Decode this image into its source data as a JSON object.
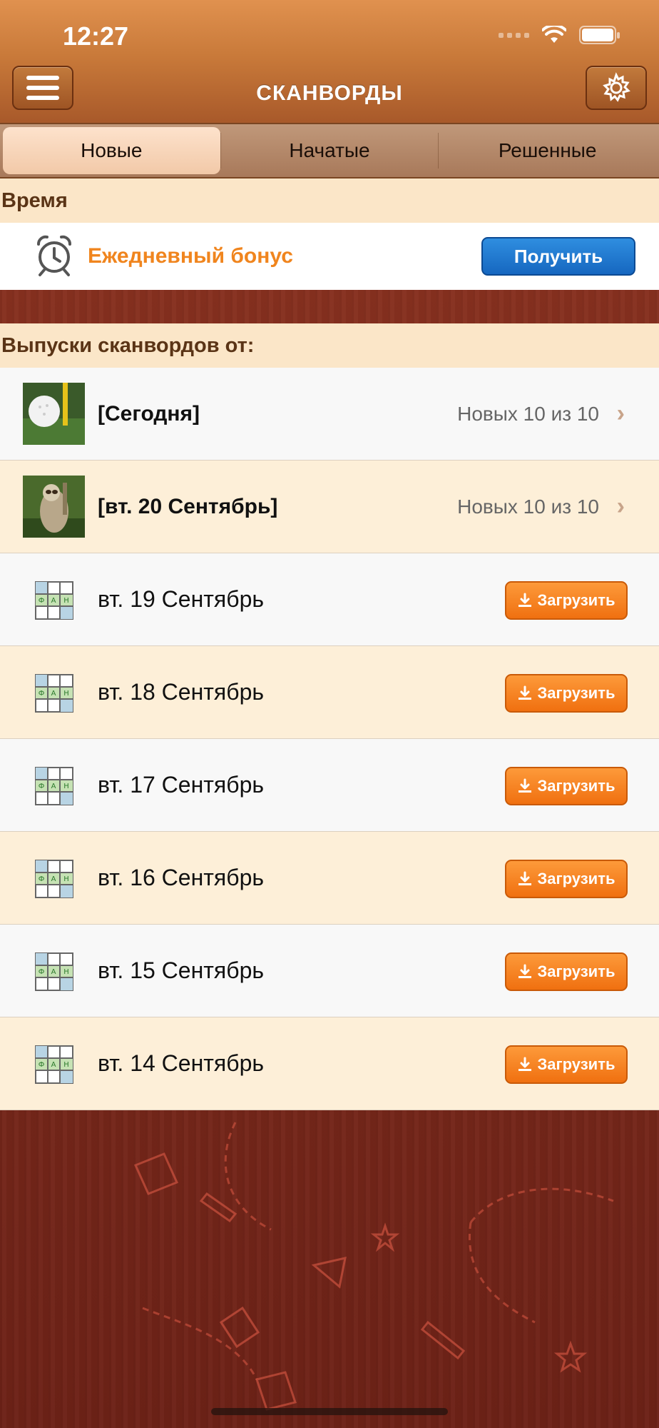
{
  "status_bar": {
    "time": "12:27"
  },
  "header": {
    "title": "СКАНВОРДЫ"
  },
  "tabs": [
    {
      "label": "Новые",
      "active": true
    },
    {
      "label": "Начатые",
      "active": false
    },
    {
      "label": "Решенные",
      "active": false
    }
  ],
  "time_section": {
    "heading": "Время",
    "bonus_label": "Ежедневный бонус",
    "get_button": "Получить"
  },
  "issues_section": {
    "heading": "Выпуски сканвордов от:",
    "featured": [
      {
        "label": "[Сегодня]",
        "status": "Новых 10 из 10",
        "thumb": "golf-ball"
      },
      {
        "label": "[вт. 20 Сентябрь]",
        "status": "Новых 10 из 10",
        "thumb": "sloth"
      }
    ],
    "downloads": [
      {
        "label": "вт. 19 Сентябрь",
        "button": "Загрузить"
      },
      {
        "label": "вт. 18 Сентябрь",
        "button": "Загрузить"
      },
      {
        "label": "вт. 17 Сентябрь",
        "button": "Загрузить"
      },
      {
        "label": "вт. 16 Сентябрь",
        "button": "Загрузить"
      },
      {
        "label": "вт. 15 Сентябрь",
        "button": "Загрузить"
      },
      {
        "label": "вт. 14 Сентябрь",
        "button": "Загрузить"
      }
    ],
    "grid_icon_letters": [
      "Ф",
      "А",
      "Н"
    ]
  },
  "colors": {
    "header": "#c97a3a",
    "accent_orange": "#f0851e",
    "button_blue": "#1667c0",
    "download_orange": "#f07010",
    "section_bg": "#fbe6c8"
  }
}
